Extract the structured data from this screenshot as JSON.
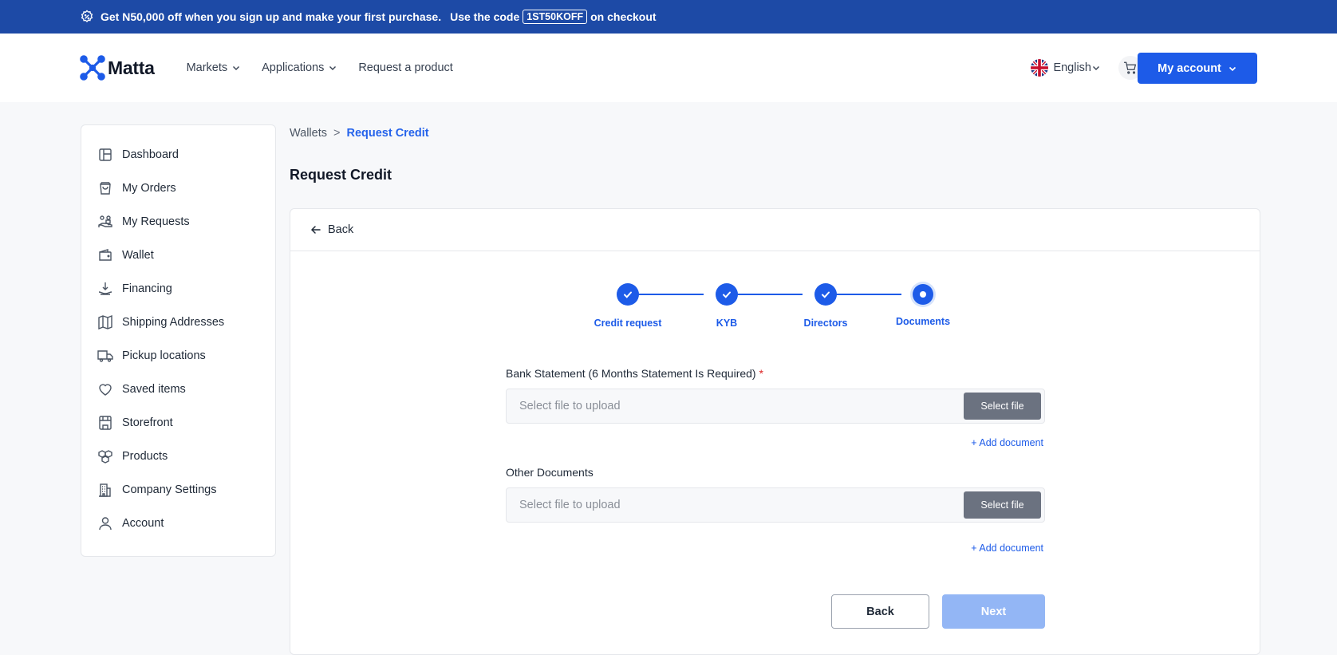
{
  "promo": {
    "text_before": "Get N50,000 off when you sign up and make your first purchase.",
    "text_use": "Use the code",
    "code": "1ST50KOFF",
    "text_after": "on checkout"
  },
  "header": {
    "logo_text": "Matta",
    "nav": [
      {
        "label": "Markets"
      },
      {
        "label": "Applications"
      },
      {
        "label": "Request a product"
      }
    ],
    "language": "English",
    "account_label": "My account"
  },
  "sidebar": {
    "items": [
      {
        "label": "Dashboard",
        "icon": "dashboard-icon"
      },
      {
        "label": "My Orders",
        "icon": "shopping-bag-icon"
      },
      {
        "label": "My Requests",
        "icon": "requests-icon"
      },
      {
        "label": "Wallet",
        "icon": "wallet-icon"
      },
      {
        "label": "Financing",
        "icon": "financing-icon"
      },
      {
        "label": "Shipping Addresses",
        "icon": "map-icon"
      },
      {
        "label": "Pickup locations",
        "icon": "truck-icon"
      },
      {
        "label": "Saved items",
        "icon": "heart-icon"
      },
      {
        "label": "Storefront",
        "icon": "storefront-icon"
      },
      {
        "label": "Products",
        "icon": "boxes-icon"
      },
      {
        "label": "Company Settings",
        "icon": "building-icon"
      },
      {
        "label": "Account",
        "icon": "user-icon"
      }
    ]
  },
  "breadcrumb": {
    "parent": "Wallets",
    "separator": ">",
    "current": "Request Credit"
  },
  "page_title": "Request Credit",
  "card": {
    "back_label": "Back",
    "steps": [
      {
        "label": "Credit request",
        "status": "complete"
      },
      {
        "label": "KYB",
        "status": "complete"
      },
      {
        "label": "Directors",
        "status": "complete"
      },
      {
        "label": "Documents",
        "status": "current"
      }
    ],
    "fields": [
      {
        "label": "Bank Statement (6 Months Statement Is Required)",
        "required": "*",
        "placeholder": "Select file to upload",
        "button": "Select file",
        "add": "+ Add document"
      },
      {
        "label": "Other Documents",
        "placeholder": "Select file to upload",
        "button": "Select file",
        "add": "+ Add document"
      }
    ],
    "back_button": "Back",
    "next_button": "Next"
  },
  "colors": {
    "primary": "#1d5be8",
    "promo_bg": "#1d4aa6",
    "next_disabled": "#93b6f5"
  }
}
